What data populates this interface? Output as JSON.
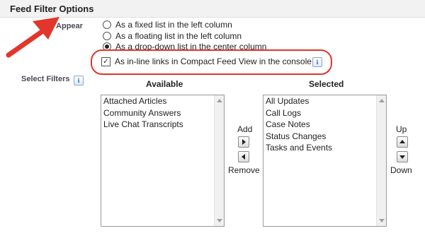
{
  "header": {
    "title": "Feed Filter Options"
  },
  "filters_appear": {
    "label": "rs Appear",
    "options": [
      {
        "label": "As a fixed list in the left column",
        "selected": false
      },
      {
        "label": "As a floating list in the left column",
        "selected": false
      },
      {
        "label": "As a drop-down list in the center column",
        "selected": true
      }
    ],
    "console_option": {
      "label": "As in-line links in Compact Feed View in the console",
      "checked": true,
      "check_mark": "✓"
    }
  },
  "info_icon_glyph": "i",
  "select_filters": {
    "label": "Select Filters",
    "available": {
      "header": "Available",
      "items": [
        "Attached Articles",
        "Community Answers",
        "Live Chat Transcripts"
      ]
    },
    "selected": {
      "header": "Selected",
      "items": [
        "All Updates",
        "Call Logs",
        "Case Notes",
        "Status Changes",
        "Tasks and Events"
      ]
    },
    "add_label": "Add",
    "remove_label": "Remove",
    "up_label": "Up",
    "down_label": "Down"
  },
  "colors": {
    "highlight": "#e2352b",
    "arrow": "#e2352b",
    "info_icon": "#1f5fad"
  }
}
